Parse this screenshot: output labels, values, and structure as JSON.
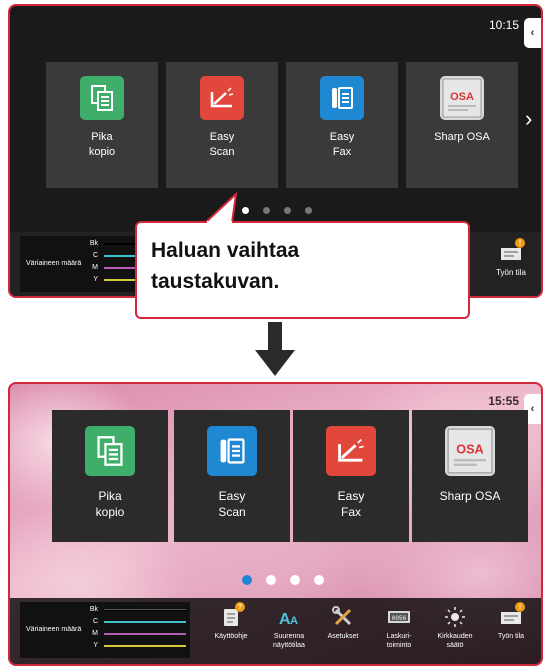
{
  "top_screen": {
    "clock": "10:15",
    "tiles": [
      {
        "label": "Pika\nkopio",
        "icon": "copy-icon",
        "color": "#3fae6a"
      },
      {
        "label": "Easy\nScan",
        "icon": "scan-icon",
        "color": "#e2473b"
      },
      {
        "label": "Easy\nFax",
        "icon": "fax-icon",
        "color": "#1e88d2"
      },
      {
        "label": "Sharp OSA",
        "icon": "osa-icon",
        "color": "#d9d9d9"
      }
    ],
    "toner_title": "Väriaineen määrä",
    "toner": [
      "Bk",
      "C",
      "M",
      "Y"
    ],
    "job_status": "Työn tila"
  },
  "callout": {
    "line1": "Haluan vaihtaa",
    "line2": "taustakuvan."
  },
  "bottom_screen": {
    "clock": "15:55",
    "tiles": [
      {
        "label": "Pika\nkopio",
        "icon": "copy-icon",
        "color": "#3fae6a"
      },
      {
        "label": "Easy\nScan",
        "icon": "fax-icon",
        "color": "#1e88d2"
      },
      {
        "label": "Easy\nFax",
        "icon": "scan-icon",
        "color": "#e2473b"
      },
      {
        "label": "Sharp OSA",
        "icon": "osa-icon",
        "color": "#d9d9d9"
      }
    ],
    "toner_title": "Väriaineen määrä",
    "toner": [
      "Bk",
      "C",
      "M",
      "Y"
    ],
    "buttons": [
      {
        "label": "Käyttöohje",
        "icon": "manual-icon"
      },
      {
        "label": "Suurenna\nnäyttötilaa",
        "icon": "enlarge-text-icon"
      },
      {
        "label": "Asetukset",
        "icon": "settings-icon"
      },
      {
        "label": "Laskuri-\ntoiminto",
        "icon": "counter-icon"
      },
      {
        "label": "Kirkkauden\nsäätö",
        "icon": "brightness-icon"
      },
      {
        "label": "Työn tila",
        "icon": "job-status-icon"
      }
    ]
  },
  "colors": {
    "accent_border": "#d2283c",
    "toner_bk": "#000000",
    "toner_c": "#3fc1c9",
    "toner_m": "#b65bb6",
    "toner_y": "#d4c83a"
  }
}
